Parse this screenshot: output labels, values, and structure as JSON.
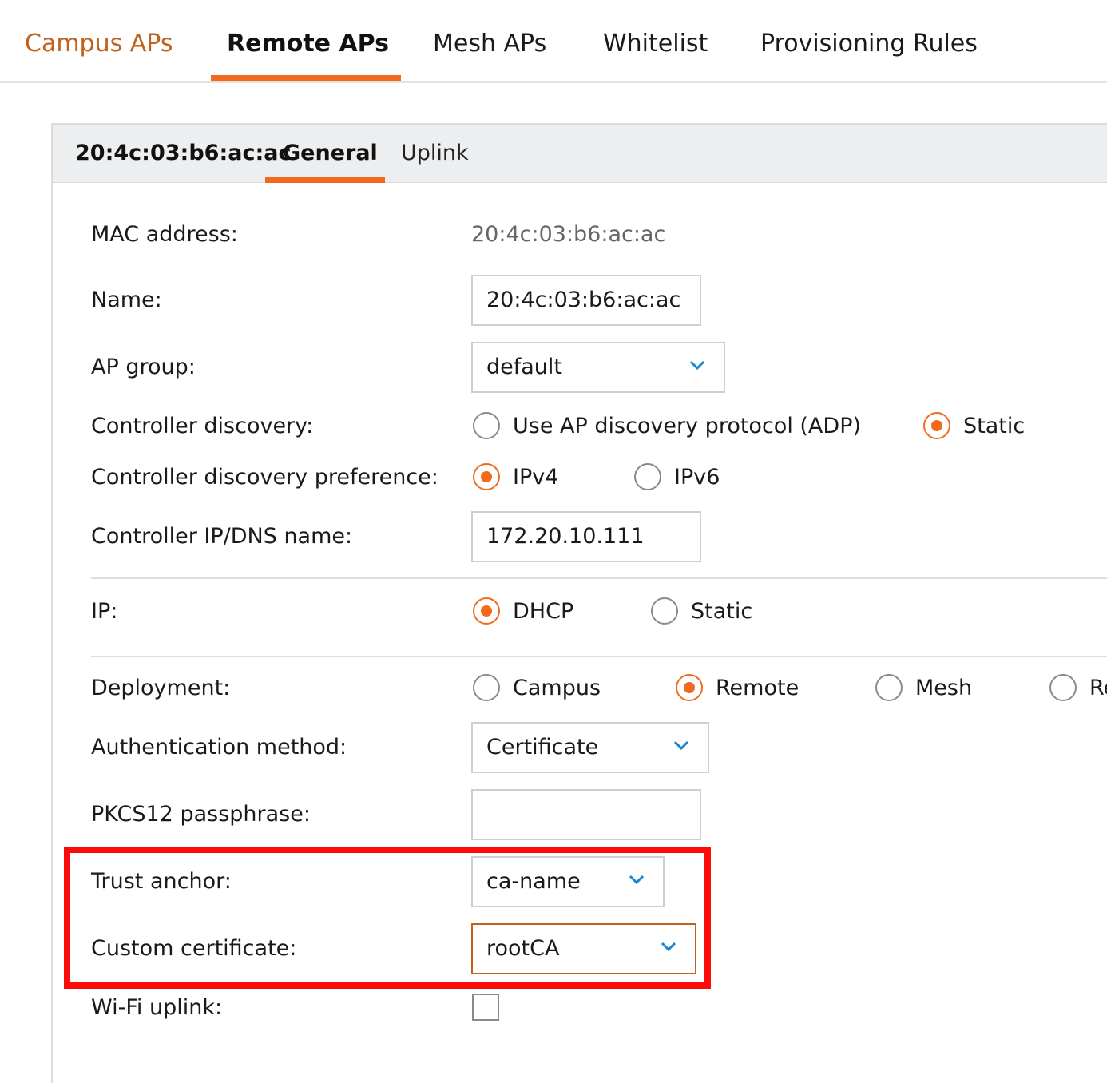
{
  "tabs": {
    "campus": "Campus APs",
    "remote": "Remote APs",
    "mesh": "Mesh APs",
    "whitelist": "Whitelist",
    "provisioning": "Provisioning Rules"
  },
  "panel": {
    "mac": "20:4c:03:b6:ac:ac",
    "general": "General",
    "uplink": "Uplink"
  },
  "form": {
    "mac_label": "MAC address:",
    "mac_value": "20:4c:03:b6:ac:ac",
    "name_label": "Name:",
    "name_value": "20:4c:03:b6:ac:ac",
    "apgroup_label": "AP group:",
    "apgroup_value": "default",
    "disc_label": "Controller discovery:",
    "disc_opt1": "Use AP discovery protocol (ADP)",
    "disc_opt2": "Static",
    "pref_label": "Controller discovery preference:",
    "pref_opt1": "IPv4",
    "pref_opt2": "IPv6",
    "ctrlip_label": "Controller IP/DNS name:",
    "ctrlip_value": "172.20.10.111",
    "ip_label": "IP:",
    "ip_opt1": "DHCP",
    "ip_opt2": "Static",
    "deploy_label": "Deployment:",
    "deploy_opt1": "Campus",
    "deploy_opt2": "Remote",
    "deploy_opt3": "Mesh",
    "deploy_opt4": "Re",
    "auth_label": "Authentication method:",
    "auth_value": "Certificate",
    "pkcs_label": "PKCS12 passphrase:",
    "pkcs_value": "",
    "trust_label": "Trust anchor:",
    "trust_value": "ca-name",
    "custom_label": "Custom certificate:",
    "custom_value": "rootCA",
    "wifi_label": "Wi-Fi uplink:"
  },
  "colors": {
    "accent": "#f26b1d",
    "highlight": "#ff0a0a",
    "chevron": "#1a86d0"
  }
}
